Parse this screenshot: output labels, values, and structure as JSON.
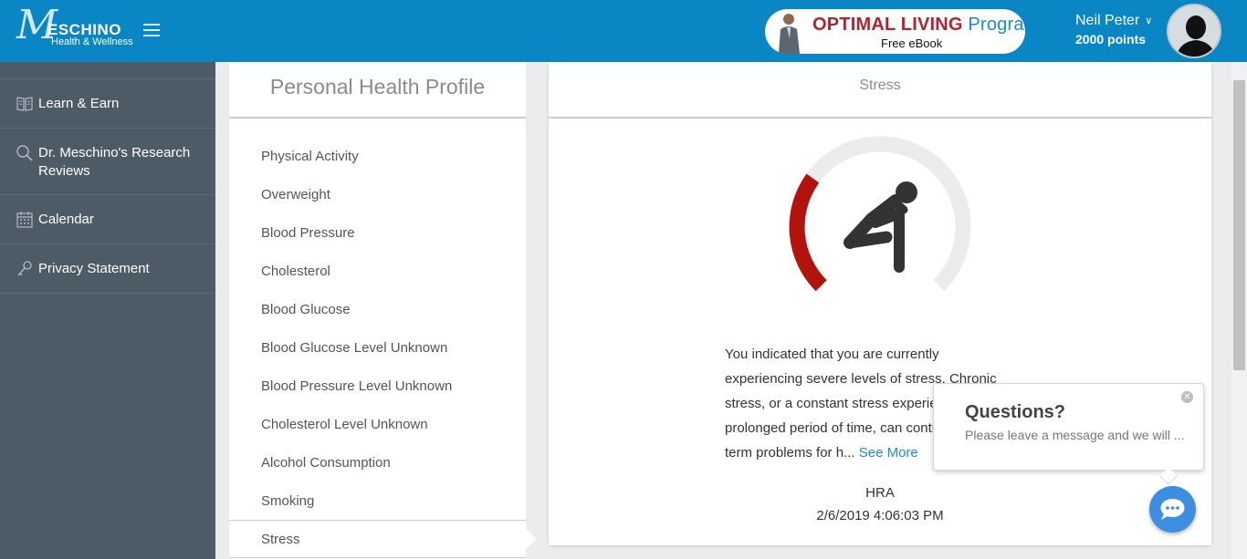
{
  "header": {
    "logo_mark": "M",
    "logo_name": "ESCHINO",
    "logo_sub": "Health & Wellness",
    "promo_title": "OPTIMAL LIVING",
    "promo_program": "Program",
    "promo_sub": "Free eBook",
    "user_name": "Neil Peter",
    "user_points": "2000 points"
  },
  "sidebar": {
    "items": [
      {
        "label": "Learn & Earn",
        "icon": "book-icon"
      },
      {
        "label": "Dr. Meschino's Research Reviews",
        "icon": "search-icon"
      },
      {
        "label": "Calendar",
        "icon": "calendar-icon"
      },
      {
        "label": "Privacy Statement",
        "icon": "key-icon"
      }
    ]
  },
  "profile": {
    "title": "Personal Health Profile",
    "items": [
      "Physical Activity",
      "Overweight",
      "Blood Pressure",
      "Cholesterol",
      "Blood Glucose",
      "Blood Glucose Level Unknown",
      "Blood Pressure Level Unknown",
      "Cholesterol Level Unknown",
      "Alcohol Consumption",
      "Smoking",
      "Stress"
    ],
    "active_item": "Stress"
  },
  "detail": {
    "title": "Stress",
    "gauge_level": 0.3,
    "colors": {
      "gauge_fill": "#b2140d",
      "gauge_track": "#ececec",
      "figure": "#333333"
    },
    "description": "You indicated that you are currently experiencing severe levels of stress. Chronic stress, or a constant stress experienced over a prolonged period of time, can contribute to long-term problems for h...",
    "see_more": "See More",
    "source": "HRA",
    "date": "2/6/2019 4:06:03 PM"
  },
  "chat": {
    "title": "Questions?",
    "message": "Please leave a message and we will ..."
  }
}
